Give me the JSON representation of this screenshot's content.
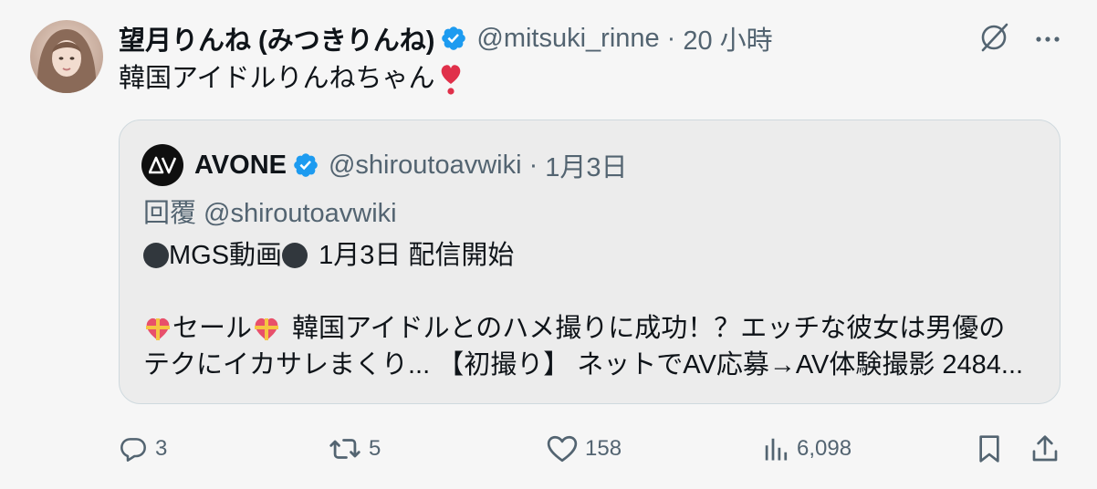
{
  "author": {
    "display_name": "望月りんね (みつきりんね)",
    "handle": "@mitsuki_rinne",
    "separator": "·",
    "time": "20 小時"
  },
  "tweet": {
    "text": "韓国アイドルりんねちゃん"
  },
  "quoted": {
    "display_name": "AVONE",
    "handle": "@shiroutoavwiki",
    "separator": "·",
    "date": "1月3日",
    "reply_to": "回覆 @shiroutoavwiki",
    "line1_text": "MGS動画",
    "line1_suffix": "1月3日 配信開始",
    "line2_a": "セール",
    "line2_b": "韓国アイドルとのハメ撮りに成功！？エッチな彼女は男優の",
    "line3": "テクにイカサレまくり... 【初撮り】 ネットでAV応募→AV体験撮影 2484..."
  },
  "actions": {
    "replies": "3",
    "retweets": "5",
    "likes": "158",
    "views": "6,098"
  },
  "icons": {
    "verified": "verified-badge-icon",
    "grok": "grok-icon",
    "more": "more-icon",
    "reply": "reply-icon",
    "retweet": "retweet-icon",
    "like": "like-icon",
    "views": "views-icon",
    "bookmark": "bookmark-icon",
    "share": "share-icon"
  },
  "colors": {
    "verified": "#1d9bf0",
    "heart_emoji": "#e0304a",
    "secondary_text": "#536471",
    "quote_border": "#cfd9de"
  }
}
